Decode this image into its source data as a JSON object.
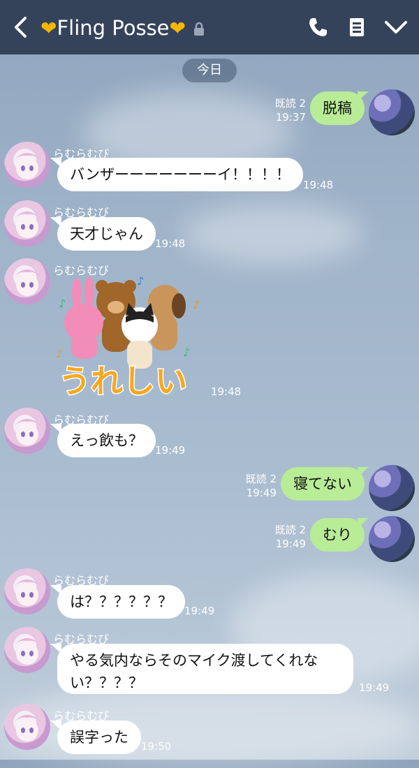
{
  "header": {
    "title_prefix_icon": "yellow-heart",
    "title": "Fling Posse",
    "title_suffix_icon": "yellow-heart",
    "lock_icon": "lock-icon",
    "icons": [
      "phone-icon",
      "notes-icon",
      "chevron-down-icon"
    ],
    "bg_color": "#35435a"
  },
  "date_label": "今日",
  "read_label": "既読 2",
  "sender_name": "らむらむび",
  "messages": [
    {
      "from": "me",
      "text": "脱稿",
      "time": "19:37",
      "read": "既読 2"
    },
    {
      "from": "other",
      "name": "らむらむび",
      "text": "バンザーーーーーーーイ！！！！",
      "time": "19:48"
    },
    {
      "from": "other",
      "name": "らむらむび",
      "text": "天才じゃん",
      "time": "19:48"
    },
    {
      "from": "other",
      "name": "らむらむび",
      "sticker": "うれしい",
      "time": "19:48"
    },
    {
      "from": "other",
      "name": "らむらむび",
      "text": "えっ飲も？",
      "time": "19:49"
    },
    {
      "from": "me",
      "text": "寝てない",
      "time": "19:49",
      "read": "既読 2"
    },
    {
      "from": "me",
      "text": "むり",
      "time": "19:49",
      "read": "既読 2"
    },
    {
      "from": "other",
      "name": "らむらむび",
      "text": "は？？？？？？",
      "time": "19:49"
    },
    {
      "from": "other",
      "name": "らむらむび",
      "text": "やる気内ならそのマイク渡してくれない？？？？",
      "time": "19:49"
    },
    {
      "from": "other",
      "name": "らむらむび",
      "text": "誤字った",
      "time": "19:50"
    }
  ],
  "colors": {
    "my_bubble": "#b8ec97",
    "other_bubble": "#ffffff",
    "heart": "#f5b800"
  }
}
